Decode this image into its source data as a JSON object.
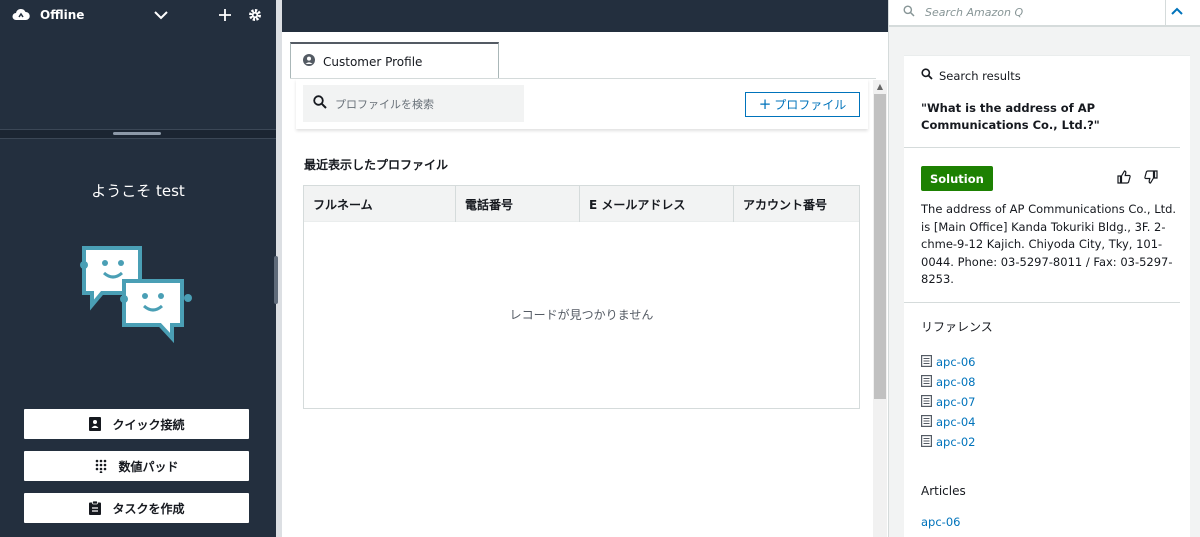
{
  "ccp": {
    "status": "Offline",
    "welcome": "ようこそ test",
    "buttons": {
      "quick_connect": "クイック接続",
      "numpad": "数値パッド",
      "create_task": "タスクを作成"
    }
  },
  "center": {
    "tab_label": "Customer Profile",
    "search_placeholder": "プロファイルを検索",
    "add_profile": "プロファイル",
    "recent_title": "最近表示したプロファイル",
    "columns": [
      "フルネーム",
      "電話番号",
      "E メールアドレス",
      "アカウント番号"
    ],
    "empty_text": "レコードが見つかりません"
  },
  "amazon_q": {
    "search_placeholder": "Search Amazon Q",
    "results_label": "Search results",
    "question": "\"What is the address of AP Communications Co., Ltd.?\"",
    "solution_badge": "Solution",
    "answer": "The address of AP Communications Co., Ltd. is [Main Office] Kanda Tokuriki Bldg., 3F. 2-chme-9-12 Kajich. Chiyoda City, Tky, 101-0044. Phone: 03-5297-8011 / Fax: 03-5297-8253.",
    "references_title": "リファレンス",
    "references": [
      "apc-06",
      "apc-08",
      "apc-07",
      "apc-04",
      "apc-02"
    ],
    "articles_title": "Articles",
    "articles": [
      "apc-06"
    ]
  },
  "colors": {
    "ccp_bg": "#232f3e",
    "link": "#0073bb",
    "solution_green": "#1d8102",
    "bubble_teal": "#4a9fb5"
  }
}
